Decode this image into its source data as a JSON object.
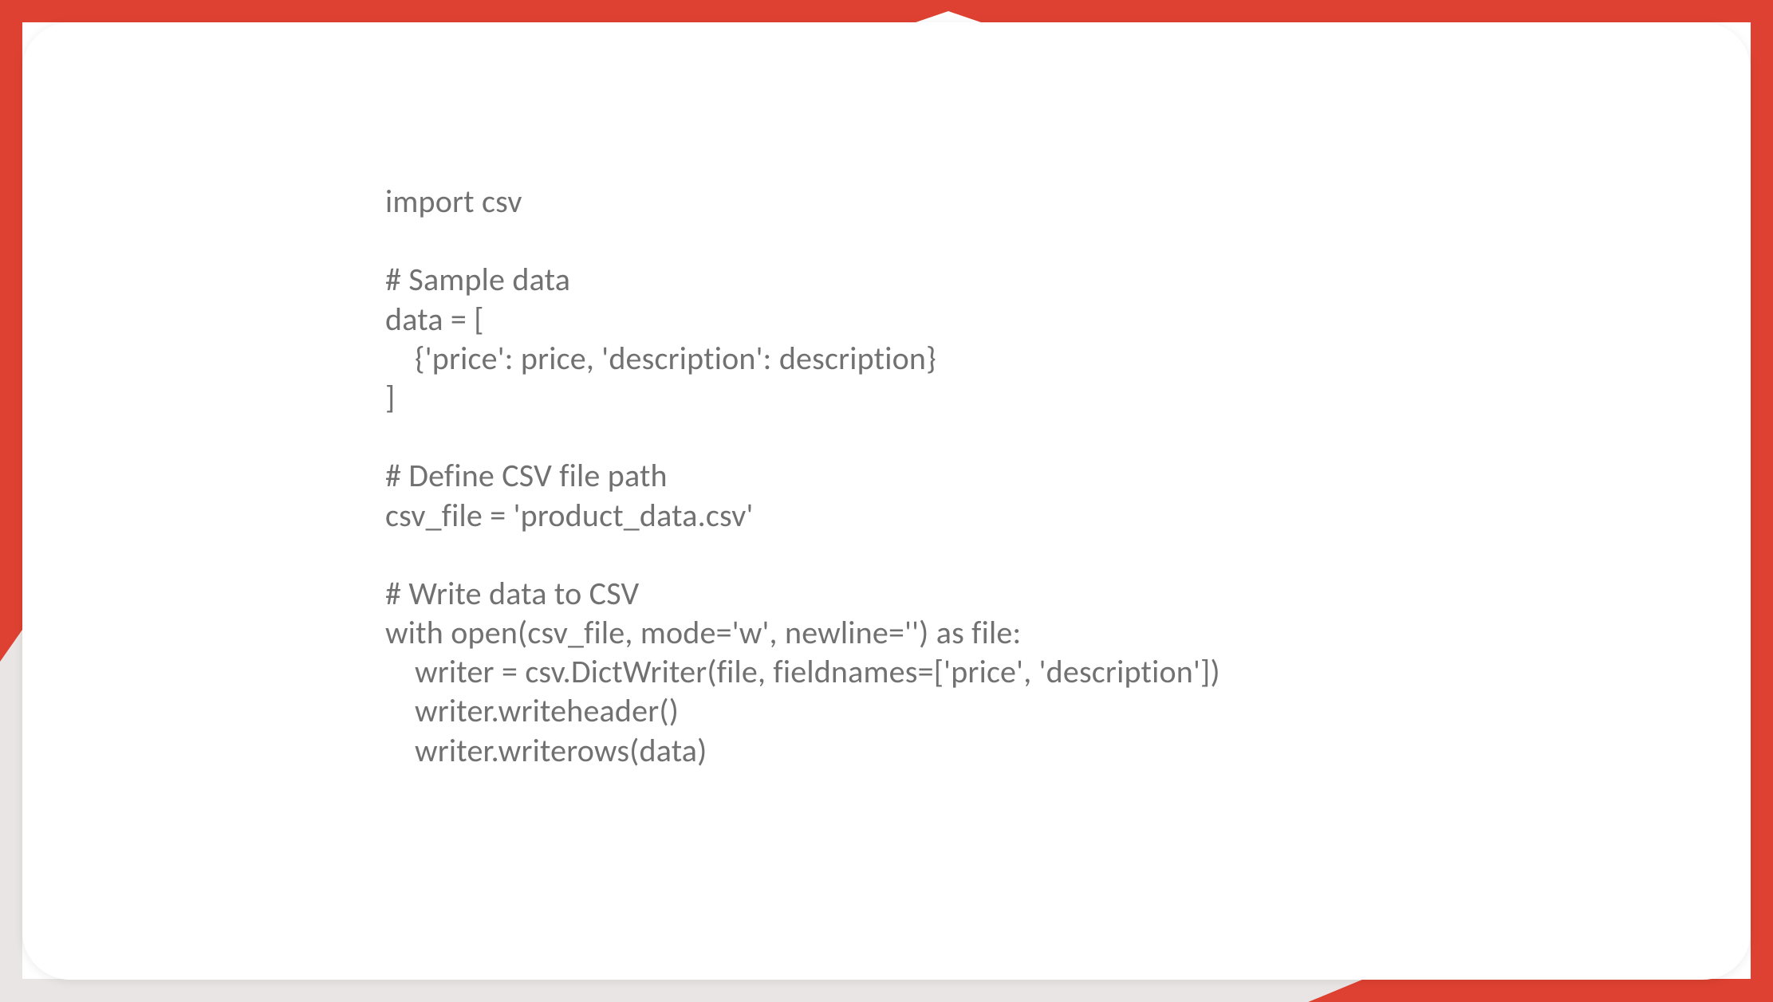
{
  "code": {
    "lines": [
      "import csv",
      "",
      "# Sample data",
      "data = [",
      "    {'price': price, 'description': description}",
      "]",
      "",
      "# Define CSV file path",
      "csv_file = 'product_data.csv'",
      "",
      "# Write data to CSV",
      "with open(csv_file, mode='w', newline='') as file:",
      "    writer = csv.DictWriter(file, fieldnames=['price', 'description'])",
      "    writer.writeheader()",
      "    writer.writerows(data)"
    ]
  },
  "colors": {
    "accent": "#de4131",
    "accent_light": "#e96a5a",
    "text": "#717171",
    "card_bg": "#ffffff"
  }
}
